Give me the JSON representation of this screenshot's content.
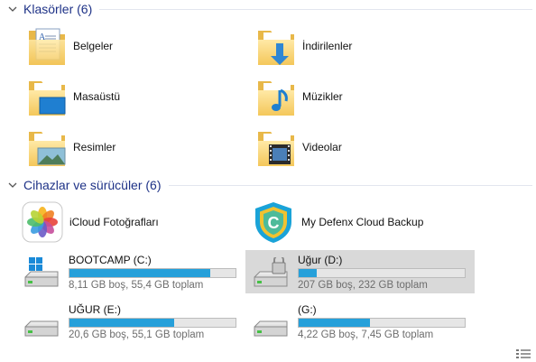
{
  "folders_group": {
    "label": "Klasörler (6)"
  },
  "folders": [
    {
      "label": "Belgeler",
      "icon": "documents-folder-icon"
    },
    {
      "label": "İndirilenler",
      "icon": "downloads-folder-icon"
    },
    {
      "label": "Masaüstü",
      "icon": "desktop-folder-icon"
    },
    {
      "label": "Müzikler",
      "icon": "music-folder-icon"
    },
    {
      "label": "Resimler",
      "icon": "pictures-folder-icon"
    },
    {
      "label": "Videolar",
      "icon": "videos-folder-icon"
    }
  ],
  "devices_group": {
    "label": "Cihazlar ve sürücüler (6)"
  },
  "apps": [
    {
      "label": "iCloud Fotoğrafları",
      "icon": "icloud-photos-icon"
    },
    {
      "label": "My Defenx Cloud Backup",
      "icon": "defenx-shield-icon"
    }
  ],
  "drives": [
    {
      "name": "BOOTCAMP (C:)",
      "info": "8,11 GB boş, 55,4 GB toplam",
      "used_fraction": 0.85,
      "icon": "windows-drive-icon",
      "selected": false
    },
    {
      "name": "Uğur (D:)",
      "info": "207 GB boş, 232 GB toplam",
      "used_fraction": 0.11,
      "icon": "locked-drive-icon",
      "selected": true
    },
    {
      "name": "UĞUR (E:)",
      "info": "20,6 GB boş, 55,1 GB toplam",
      "used_fraction": 0.63,
      "icon": "hard-drive-icon",
      "selected": false
    },
    {
      "name": " (G:)",
      "info": "4,22 GB boş, 7,45 GB toplam",
      "used_fraction": 0.43,
      "icon": "hard-drive-icon",
      "selected": false
    }
  ],
  "colors": {
    "bar_fill": "#26a0da",
    "header_text": "#1e3287",
    "selection": "#d9d9d9"
  }
}
